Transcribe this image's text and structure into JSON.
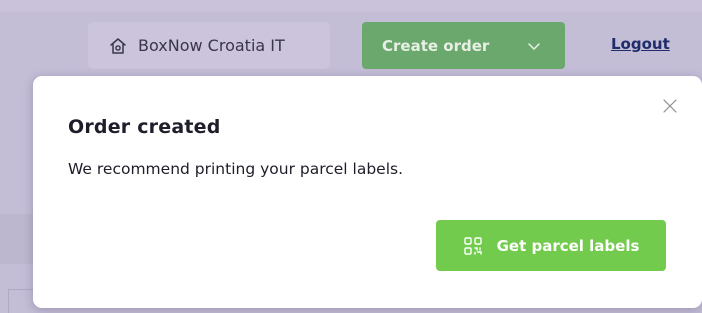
{
  "header": {
    "account_label": "BoxNow Croatia IT",
    "account_icon": "home-icon",
    "create_order_label": "Create order",
    "create_order_icon": "chevron-down-icon",
    "logout_label": "Logout"
  },
  "modal": {
    "title": "Order created",
    "message": "We recommend printing your parcel labels.",
    "close_icon": "close-icon",
    "primary_button_label": "Get parcel labels",
    "primary_button_icon": "qr-code-icon"
  },
  "colors": {
    "overlay": "#c4bdd6",
    "create_order_button": "#6aa86d",
    "primary_button": "#72cb4d",
    "logout_link": "#1f2e6b"
  }
}
